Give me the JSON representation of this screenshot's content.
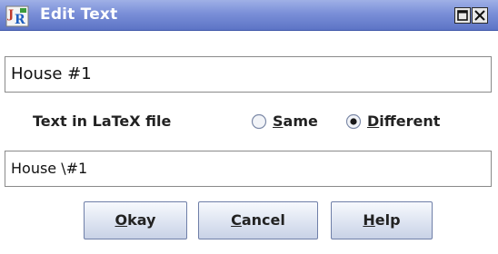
{
  "window": {
    "title": "Edit Text",
    "icon": "jr-app-icon",
    "controls": [
      "maximize-icon",
      "close-icon"
    ]
  },
  "text_field": {
    "value": "House #1"
  },
  "latex_option": {
    "label": "Text in LaTeX file",
    "options": [
      {
        "mnemonic": "S",
        "rest": "ame",
        "label": "Same",
        "selected": false
      },
      {
        "mnemonic": "D",
        "rest": "ifferent",
        "label": "Different",
        "selected": true
      }
    ]
  },
  "latex_field": {
    "value": "House \\#1"
  },
  "buttons": {
    "okay": {
      "mnemonic": "O",
      "rest": "kay",
      "label": "Okay"
    },
    "cancel": {
      "mnemonic": "C",
      "rest": "ancel",
      "label": "Cancel"
    },
    "help": {
      "mnemonic": "H",
      "rest": "elp",
      "label": "Help"
    }
  },
  "colors": {
    "titlebar": "#7a8fd8",
    "button_border": "#6f7fa8"
  }
}
